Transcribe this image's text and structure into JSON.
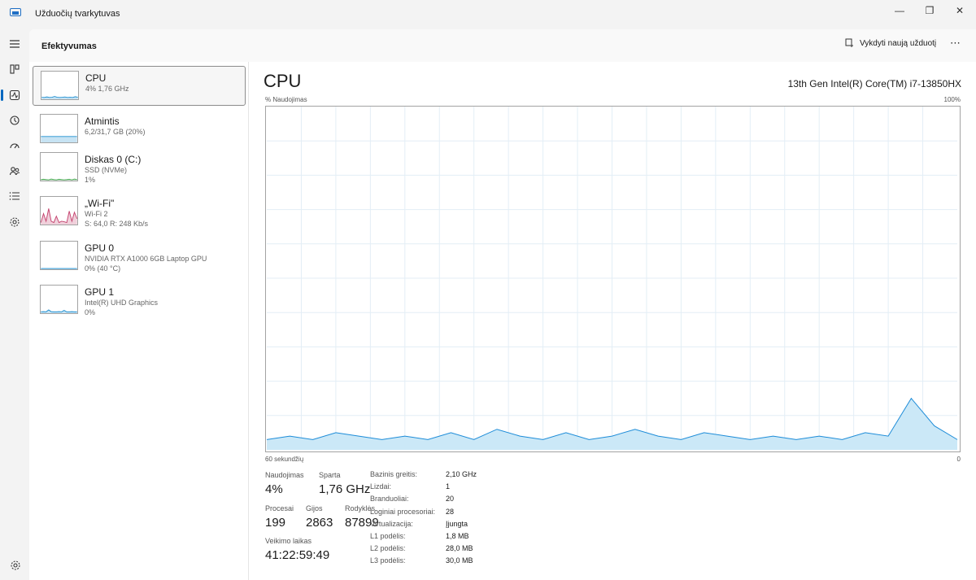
{
  "app": {
    "title": "Užduočių tvarkytuvas"
  },
  "window_controls": {
    "minimize": "—",
    "maximize": "❐",
    "close": "✕"
  },
  "header": {
    "title": "Efektyvumas",
    "run_task_label": "Vykdyti naują užduotį",
    "more_label": "⋯"
  },
  "nav": {
    "icons": [
      "hamburger-icon",
      "processes-icon",
      "performance-icon",
      "app-history-icon",
      "startup-apps-icon",
      "users-icon",
      "details-icon",
      "services-icon",
      "settings-icon"
    ],
    "active": "performance-icon"
  },
  "perf_list": [
    {
      "name": "CPU",
      "lines": [
        "4% 1,76 GHz"
      ],
      "selected": true,
      "color": "#1f8fd1",
      "history": [
        0.05,
        0.04,
        0.06,
        0.04,
        0.05,
        0.08,
        0.05,
        0.04,
        0.05,
        0.06,
        0.04,
        0.05,
        0.04,
        0.07,
        0.05
      ]
    },
    {
      "name": "Atmintis",
      "lines": [
        "6,2/31,7 GB (20%)"
      ],
      "selected": false,
      "color": "#1f8fd1",
      "history": [
        0.2,
        0.2,
        0.2,
        0.2,
        0.2,
        0.2,
        0.2,
        0.2,
        0.2,
        0.2,
        0.2,
        0.2,
        0.2,
        0.2,
        0.2
      ]
    },
    {
      "name": "Diskas 0 (C:)",
      "lines": [
        "SSD (NVMe)",
        "1%"
      ],
      "selected": false,
      "color": "#4daa57",
      "history": [
        0.01,
        0.02,
        0.01,
        0.0,
        0.03,
        0.01,
        0.0,
        0.02,
        0.01,
        0.0,
        0.01,
        0.02,
        0.0,
        0.03,
        0.01
      ]
    },
    {
      "name": "„Wi-Fi\"",
      "lines": [
        "Wi-Fi 2",
        "S: 64,0 R: 248 Kb/s"
      ],
      "selected": false,
      "color": "#c4426e",
      "history": [
        0.05,
        0.4,
        0.1,
        0.6,
        0.1,
        0.05,
        0.3,
        0.05,
        0.1,
        0.08,
        0.05,
        0.5,
        0.1,
        0.45,
        0.2
      ]
    },
    {
      "name": "GPU 0",
      "lines": [
        "NVIDIA RTX A1000 6GB Laptop GPU",
        "0% (40 °C)"
      ],
      "selected": false,
      "color": "#1f8fd1",
      "history": [
        0,
        0,
        0,
        0,
        0,
        0,
        0,
        0,
        0,
        0,
        0,
        0,
        0,
        0,
        0
      ]
    },
    {
      "name": "GPU 1",
      "lines": [
        "Intel(R) UHD Graphics",
        "0%"
      ],
      "selected": false,
      "color": "#1f8fd1",
      "history": [
        0.02,
        0.03,
        0.02,
        0.1,
        0.03,
        0.02,
        0.02,
        0.03,
        0.02,
        0.08,
        0.02,
        0.02,
        0.03,
        0.02,
        0.02
      ]
    }
  ],
  "detail": {
    "title": "CPU",
    "model": "13th Gen Intel(R) Core(TM) i7-13850HX",
    "graph_top_left": "% Naudojimas",
    "graph_top_right": "100%",
    "graph_bottom_left": "60 sekundžių",
    "graph_bottom_right": "0",
    "line_color": "#1d8cd8",
    "fill_color": "#cbe8f7",
    "grid_color": "#e3eef6"
  },
  "chart_data": {
    "type": "area",
    "x": [
      60,
      58,
      56,
      54,
      52,
      50,
      48,
      46,
      44,
      42,
      40,
      38,
      36,
      34,
      32,
      30,
      28,
      26,
      24,
      22,
      20,
      18,
      16,
      14,
      12,
      10,
      8,
      6,
      4,
      2,
      0
    ],
    "values": [
      3,
      4,
      3,
      5,
      4,
      3,
      4,
      3,
      5,
      3,
      6,
      4,
      3,
      5,
      3,
      4,
      6,
      4,
      3,
      5,
      4,
      3,
      4,
      3,
      4,
      3,
      5,
      4,
      15,
      7,
      3
    ],
    "ylim": [
      0,
      100
    ],
    "xlabel": "60 sekundžių",
    "ylabel": "% Naudojimas"
  },
  "stats": {
    "usage_label": "Naudojimas",
    "usage_value": "4%",
    "speed_label": "Sparta",
    "speed_value": "1,76 GHz",
    "processes_label": "Procesai",
    "processes_value": "199",
    "threads_label": "Gijos",
    "threads_value": "2863",
    "handles_label": "Rodyklės",
    "handles_value": "87899",
    "uptime_label": "Veikimo laikas",
    "uptime_value": "41:22:59:49"
  },
  "specs": [
    {
      "label": "Bazinis greitis:",
      "value": "2,10 GHz"
    },
    {
      "label": "Lizdai:",
      "value": "1"
    },
    {
      "label": "Branduoliai:",
      "value": "20"
    },
    {
      "label": "Loginiai procesoriai:",
      "value": "28"
    },
    {
      "label": "Virtualizacija:",
      "value": "Įjungta"
    },
    {
      "label": "L1 podėlis:",
      "value": "1,8 MB"
    },
    {
      "label": "L2 podėlis:",
      "value": "28,0 MB"
    },
    {
      "label": "L3 podėlis:",
      "value": "30,0 MB"
    }
  ]
}
